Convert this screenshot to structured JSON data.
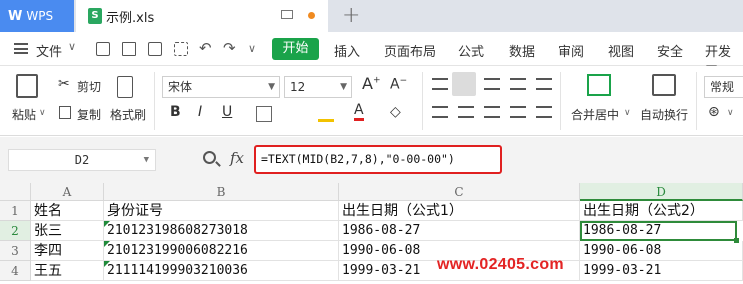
{
  "titlebar": {
    "app_tab": "WPS",
    "doc_tab": "示例.xls",
    "new_tab": "+"
  },
  "menubar": {
    "file": "文件",
    "start": "开始",
    "items": [
      "插入",
      "页面布局",
      "公式",
      "数据",
      "审阅",
      "视图",
      "安全",
      "开发工"
    ]
  },
  "ribbon": {
    "paste": "粘贴",
    "cut": "剪切",
    "copy": "复制",
    "format_painter": "格式刷",
    "font_name": "宋体",
    "font_size": "12",
    "merge_center": "合并居中",
    "wrap_text": "自动换行",
    "number_format": "常规"
  },
  "formula_bar": {
    "cell_ref": "D2",
    "fx": "fx",
    "formula": "=TEXT(MID(B2,7,8),\"0-00-00\")"
  },
  "grid": {
    "columns": [
      "A",
      "B",
      "C",
      "D"
    ],
    "rows": [
      "1",
      "2",
      "3",
      "4"
    ],
    "headers": [
      "姓名",
      "身份证号",
      "出生日期（公式1）",
      "出生日期（公式2）"
    ],
    "data": [
      [
        "张三",
        "210123198608273018",
        "1986-08-27",
        "1986-08-27"
      ],
      [
        "李四",
        "210123199006082216",
        "1990-06-08",
        "1990-06-08"
      ],
      [
        "王五",
        "211114199903210036",
        "1999-03-21",
        "1999-03-21"
      ]
    ]
  },
  "watermark": "www.02405.com"
}
